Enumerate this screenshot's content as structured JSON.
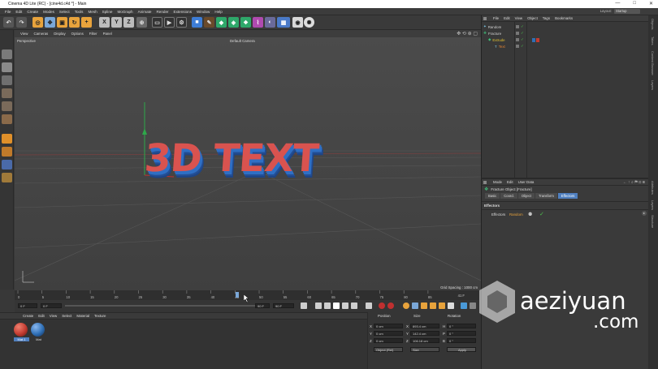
{
  "window": {
    "title": "Cinema 4D Lite (RC) - [cine4d.c4d *] - Main",
    "controls": [
      "—",
      "□",
      "✕"
    ]
  },
  "menubar": {
    "items": [
      "File",
      "Edit",
      "Create",
      "Modes",
      "Select",
      "Tools",
      "Mesh",
      "Spline",
      "MoGraph",
      "Animate",
      "Render",
      "Extensions",
      "Window",
      "Help"
    ],
    "layout_label": "Layout:",
    "layout_value": "Startup"
  },
  "toolbar": {
    "axis_x": "X",
    "axis_y": "Y",
    "axis_z": "Z"
  },
  "viewport": {
    "menu": [
      "View",
      "Cameras",
      "Display",
      "Options",
      "Filter",
      "Panel"
    ],
    "view_name": "Perspective",
    "camera_label": "Default Camera",
    "scene_text": "3D TEXT",
    "grid_spacing": "Grid Spacing : 1000 cm"
  },
  "timeline": {
    "ticks": [
      "0",
      "5",
      "10",
      "15",
      "20",
      "25",
      "30",
      "35",
      "40",
      "45",
      "50",
      "55",
      "60",
      "65",
      "70",
      "75",
      "80",
      "85"
    ],
    "start_field": "0 F",
    "current_field": "0 F",
    "end_field": "90 F",
    "end_field2": "90 F",
    "frame_counter": "41 F"
  },
  "materials": {
    "menu": [
      "Create",
      "Edit",
      "View",
      "Select",
      "Material",
      "Texture"
    ],
    "items": [
      {
        "name": "Mat.1",
        "color": "#c23b30"
      },
      {
        "name": "Mat",
        "color": "#2f6fb5"
      }
    ]
  },
  "coordinates": {
    "headers": [
      "Position",
      "Size",
      "Rotation"
    ],
    "rows": [
      {
        "axis": "X",
        "pos": "0 cm",
        "size_axis": "X",
        "size": "893.4 cm",
        "rot_axis": "H",
        "rot": "0 °"
      },
      {
        "axis": "Y",
        "pos": "0 cm",
        "size_axis": "Y",
        "size": "142.4 cm",
        "rot_axis": "P",
        "rot": "0 °"
      },
      {
        "axis": "Z",
        "pos": "0 cm",
        "size_axis": "Z",
        "size": "106.18 cm",
        "rot_axis": "B",
        "rot": "0 °"
      }
    ],
    "mode_select": "Object (Rel)",
    "size_select": "Size",
    "apply_label": "Apply"
  },
  "objects": {
    "menu": [
      "File",
      "Edit",
      "View",
      "Object",
      "Tags",
      "Bookmarks"
    ],
    "tree": [
      {
        "name": "Random",
        "indent": 0,
        "color": "#cfcfcf"
      },
      {
        "name": "Fracture",
        "indent": 0,
        "color": "#cfcfcf"
      },
      {
        "name": "Extrude",
        "indent": 1,
        "color": "#e0c030"
      },
      {
        "name": "Text",
        "indent": 2,
        "color": "#e08030"
      }
    ]
  },
  "attributes": {
    "menu": [
      "Mode",
      "Edit",
      "User Data"
    ],
    "object_title": "Fracture Object [Fracture]",
    "tabs": [
      "Basic",
      "Coord.",
      "Object",
      "Transform",
      "Effectors"
    ],
    "active_tab": "Effectors",
    "section": "Effectors",
    "field_label": "Effectors",
    "effector_name": "Random"
  },
  "side_tabs": [
    "Objects",
    "Takes",
    "Content Browser",
    "Layers",
    "Attributes",
    "Layers",
    "Structure"
  ],
  "watermark": {
    "brand": "aeziyuan",
    "domain": ".com"
  },
  "colors": {
    "text_red": "#d9534f",
    "text_blue": "#2f6fc4",
    "accent_blue": "#4f7fbf"
  }
}
